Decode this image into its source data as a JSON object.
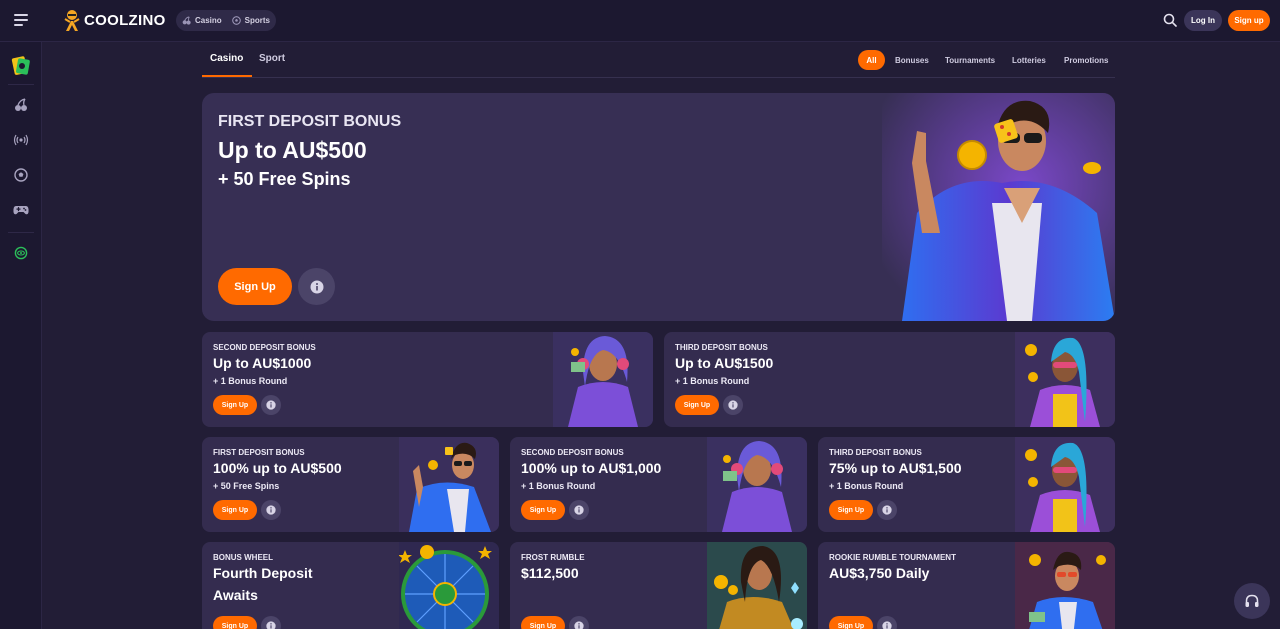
{
  "header": {
    "brand": "COOLZINO",
    "modes": [
      {
        "label": "Casino",
        "icon": "cherry-icon"
      },
      {
        "label": "Sports",
        "icon": "soccer-ball-icon"
      }
    ],
    "login_label": "Log In",
    "signup_label": "Sign up"
  },
  "rail": {
    "items": [
      "wallet-card-icon",
      "cherry-icon",
      "live-broadcast-icon",
      "soccer-ball-icon",
      "gamepad-icon",
      "eye-icon"
    ]
  },
  "subnav": {
    "tabs": [
      {
        "label": "Casino",
        "active": true
      },
      {
        "label": "Sport",
        "active": false
      }
    ],
    "filters": [
      "All",
      "Bonuses",
      "Tournaments",
      "Lotteries",
      "Promotions"
    ]
  },
  "hero": {
    "kicker": "FIRST DEPOSIT BONUS",
    "title": "Up to AU$500",
    "subtitle": "+ 50 Free Spins",
    "cta": "Sign Up"
  },
  "cards": [
    {
      "kicker": "SECOND DEPOSIT BONUS",
      "title": "Up to AU$1000",
      "sub": "+ 1 Bonus Round",
      "cta": "Sign Up"
    },
    {
      "kicker": "THIRD DEPOSIT BONUS",
      "title": "Up to AU$1500",
      "sub": "+ 1 Bonus Round",
      "cta": "Sign Up"
    },
    {
      "kicker": "FIRST DEPOSIT BONUS",
      "title": "100% up to  AU$500",
      "sub": "+ 50 Free Spins",
      "cta": "Sign Up"
    },
    {
      "kicker": "SECOND DEPOSIT BONUS",
      "title": "100% up to  AU$1,000",
      "sub": "+ 1 Bonus Round",
      "cta": "Sign Up"
    },
    {
      "kicker": "THIRD DEPOSIT BONUS",
      "title": "75% up to  AU$1,500",
      "sub": "+ 1 Bonus Round",
      "cta": "Sign Up"
    },
    {
      "kicker": "BONUS WHEEL",
      "title": "Fourth Deposit",
      "title2": "Awaits",
      "cta": "Sign Up"
    },
    {
      "kicker": "FROST RUMBLE",
      "title": "$112,500",
      "cta": "Sign Up"
    },
    {
      "kicker": "ROOKIE RUMBLE TOURNAMENT",
      "title": "AU$3,750 Daily",
      "cta": "Sign Up"
    }
  ],
  "colors": {
    "background": "#221d36",
    "card": "#342c4f",
    "accent": "#ff6a00"
  },
  "support_icon": "headset-icon"
}
